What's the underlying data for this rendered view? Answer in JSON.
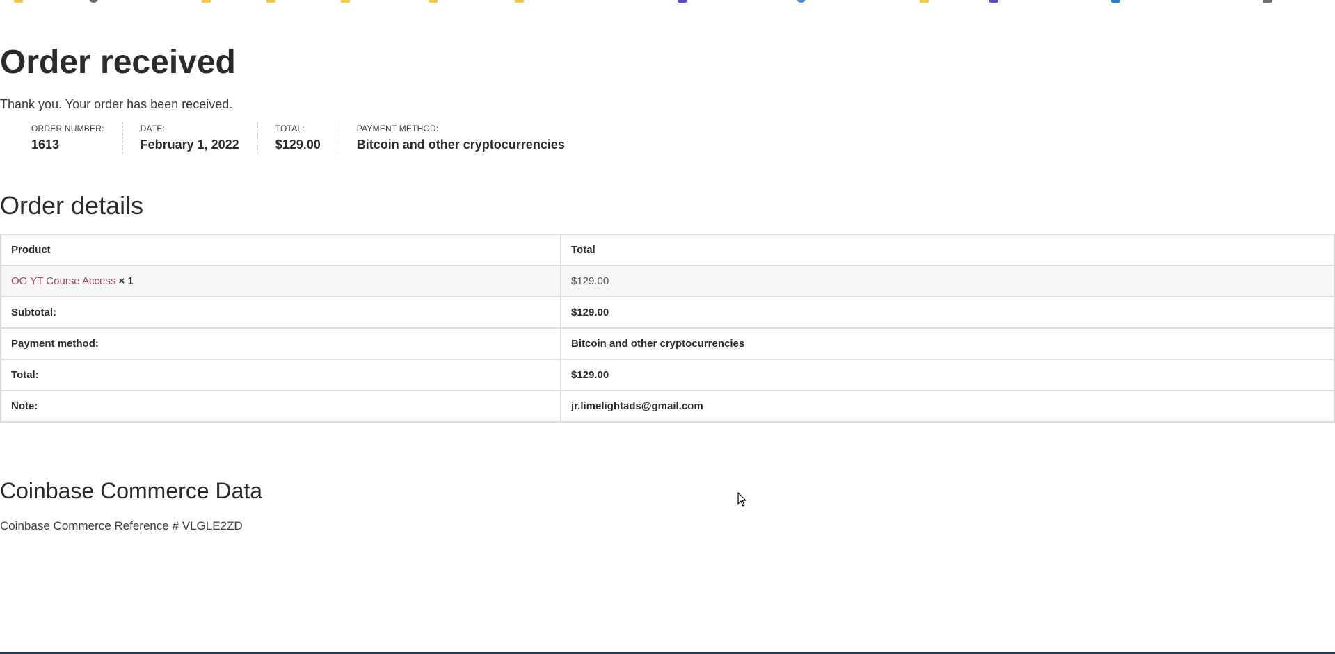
{
  "page": {
    "title": "Order received",
    "thank_you": "Thank you. Your order has been received."
  },
  "overview": {
    "order_number_label": "ORDER NUMBER:",
    "order_number": "1613",
    "date_label": "DATE:",
    "date": "February 1, 2022",
    "total_label": "TOTAL:",
    "total": "$129.00",
    "payment_method_label": "PAYMENT METHOD:",
    "payment_method": "Bitcoin and other cryptocurrencies"
  },
  "order_details": {
    "heading": "Order details",
    "columns": [
      "Product",
      "Total"
    ],
    "item": {
      "name": "OG YT Course Access",
      "quantity": "× 1",
      "total": "$129.00"
    },
    "rows": [
      {
        "label": "Subtotal:",
        "value": "$129.00"
      },
      {
        "label": "Payment method:",
        "value": "Bitcoin and other cryptocurrencies"
      },
      {
        "label": "Total:",
        "value": "$129.00"
      },
      {
        "label": "Note:",
        "value": "jr.limelightads@gmail.com"
      }
    ]
  },
  "coinbase": {
    "heading": "Coinbase Commerce Data",
    "reference": "Coinbase Commerce Reference # VLGLE2ZD"
  },
  "bookmarks_icons": [
    "folder-icon",
    "globe-icon",
    "folder-icon",
    "folder-icon",
    "folder-icon",
    "folder-icon",
    "folder-icon",
    "app-icon",
    "globe-icon",
    "folder-icon",
    "app-icon",
    "app-icon",
    "page-icon"
  ],
  "colors": {
    "link": "#a3466b",
    "text": "#2b2b2b",
    "border": "#dcdcdc"
  }
}
